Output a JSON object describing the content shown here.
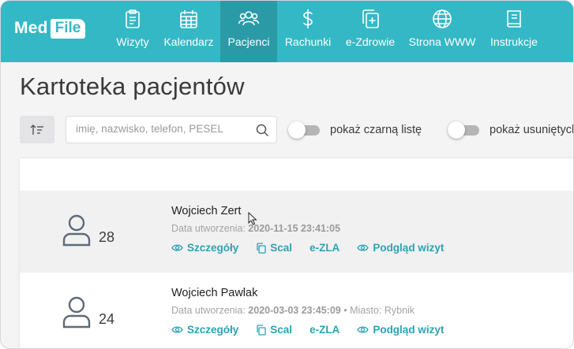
{
  "logo": {
    "part1": "Med",
    "part2": "File"
  },
  "nav": [
    {
      "label": "Wizyty",
      "icon": "clipboard-icon",
      "active": false
    },
    {
      "label": "Kalendarz",
      "icon": "calendar-icon",
      "active": false
    },
    {
      "label": "Pacjenci",
      "icon": "users-icon",
      "active": true
    },
    {
      "label": "Rachunki",
      "icon": "dollar-icon",
      "active": false
    },
    {
      "label": "e-Zdrowie",
      "icon": "medical-copy-icon",
      "active": false
    },
    {
      "label": "Strona WWW",
      "icon": "globe-icon",
      "active": false
    },
    {
      "label": "Instrukcje",
      "icon": "book-icon",
      "active": false
    }
  ],
  "page": {
    "title": "Kartoteka pacjentów"
  },
  "search": {
    "placeholder": "imię, nazwisko, telefon, PESEL",
    "value": ""
  },
  "toggles": {
    "blacklist": {
      "label": "pokaż czarną listę",
      "on": false
    },
    "deleted": {
      "label": "pokaż usuniętych",
      "on": false
    }
  },
  "patients": [
    {
      "count": "28",
      "name": "Wojciech Zert",
      "created_label": "Data utworzenia:",
      "created": "2020-11-15 23:41:05",
      "extra": "",
      "actions": {
        "details": "Szczegóły",
        "merge": "Scal",
        "ezla": "e-ZLA",
        "preview": "Podgląd wizyt"
      }
    },
    {
      "count": "24",
      "name": "Wojciech Pawlak",
      "created_label": "Data utworzenia:",
      "created": "2020-03-03 23:45:09",
      "extra": "• Miasto: Rybnik",
      "actions": {
        "details": "Szczegóły",
        "merge": "Scal",
        "ezla": "e-ZLA",
        "preview": "Podgląd wizyt"
      }
    }
  ],
  "colors": {
    "brand": "#35b8c5",
    "active_nav": "#2a9aa6",
    "link": "#2ba3b3"
  }
}
